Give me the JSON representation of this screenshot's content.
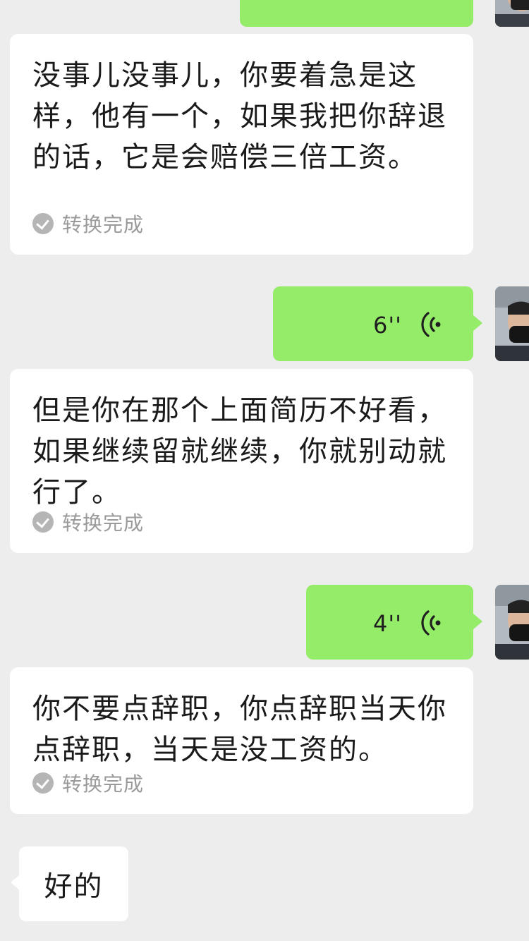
{
  "messages": {
    "transcript_1": {
      "text": "没事儿没事儿，你要着急是这样，他有一个，如果我把你辞退的话，它是会赔偿三倍工资。",
      "status": "转换完成"
    },
    "voice_1": {
      "duration": "6''"
    },
    "transcript_2": {
      "text": "但是你在那个上面简历不好看，如果继续留就继续，你就别动就行了。",
      "status": "转换完成"
    },
    "voice_2": {
      "duration": "4''"
    },
    "transcript_3": {
      "text": "你不要点辞职，你点辞职当天你点辞职，当天是没工资的。",
      "status": "转换完成"
    },
    "reply_1": {
      "text": "好的"
    }
  },
  "icons": {
    "voice": "voice-wave-icon",
    "check": "check-circle-icon",
    "avatar": "user-avatar"
  },
  "colors": {
    "background": "#ededed",
    "sent_bubble": "#95ec69",
    "received_bubble": "#ffffff",
    "status_gray": "#9a9a9a"
  }
}
